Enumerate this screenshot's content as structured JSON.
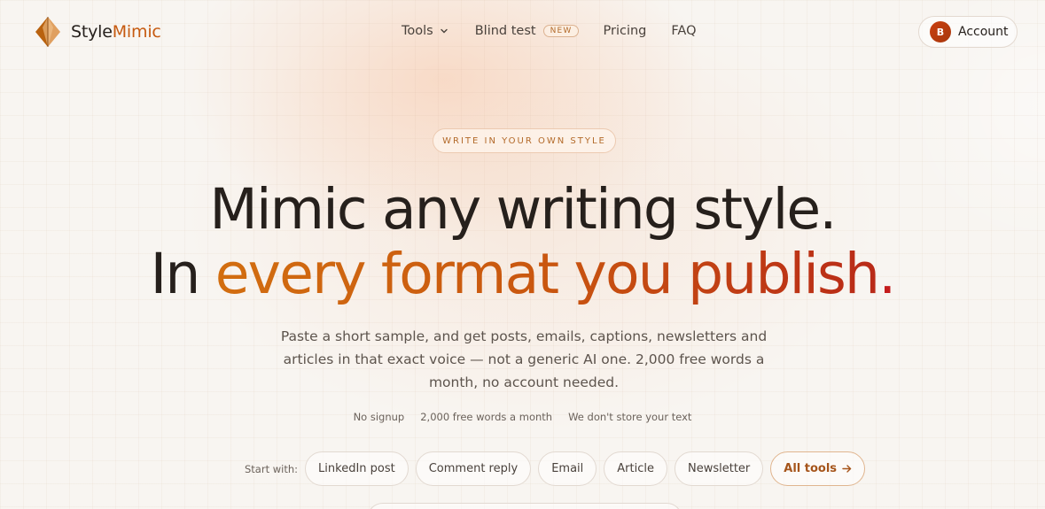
{
  "brand": {
    "name_part1": "Style",
    "name_part2": "Mimic"
  },
  "nav": {
    "tools": "Tools",
    "blind_test": "Blind test",
    "new_badge": "NEW",
    "pricing": "Pricing",
    "faq": "FAQ"
  },
  "account": {
    "avatar_initial": "B",
    "label": "Account"
  },
  "hero": {
    "eyebrow": "WRITE IN YOUR OWN STYLE",
    "line1": "Mimic any writing style.",
    "line2_prefix": "In ",
    "line2_highlight": "every format you publish",
    "line2_dot": ".",
    "subtitle": "Paste a short sample, and get posts, emails, captions, newsletters and articles in that exact voice — not a generic AI one. 2,000 free words a month, no account needed."
  },
  "features": [
    "No signup",
    "2,000 free words a month",
    "We don't store your text"
  ],
  "start_with": {
    "label": "Start with:",
    "chips": [
      "LinkedIn post",
      "Comment reply",
      "Email",
      "Article",
      "Newsletter"
    ],
    "all_tools": "All tools"
  },
  "colors": {
    "accent": "#c65a10",
    "gradient_start": "#d26e10",
    "gradient_end": "#b92a18",
    "background": "#f8f5f1"
  }
}
